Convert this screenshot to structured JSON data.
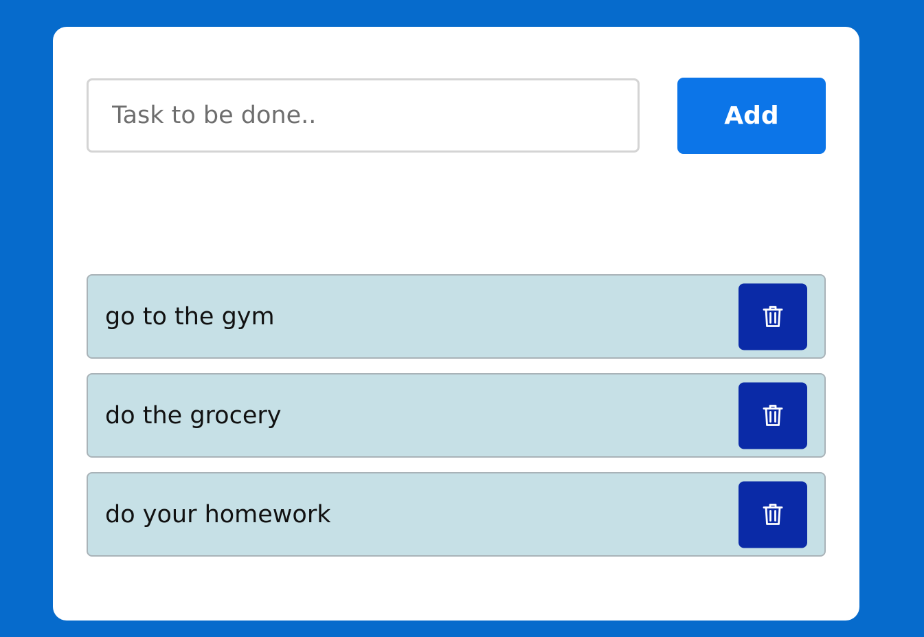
{
  "colors": {
    "background": "#066bcc",
    "card": "#ffffff",
    "add_button": "#0c75e8",
    "task_item": "#c6e0e6",
    "delete_button": "#0a2aa7"
  },
  "form": {
    "input_placeholder": "Task to be done..",
    "input_value": "",
    "add_label": "Add"
  },
  "tasks": [
    {
      "text": "go to the gym",
      "icon": "trash-icon"
    },
    {
      "text": "do the grocery",
      "icon": "trash-icon"
    },
    {
      "text": "do your homework",
      "icon": "trash-icon"
    }
  ]
}
